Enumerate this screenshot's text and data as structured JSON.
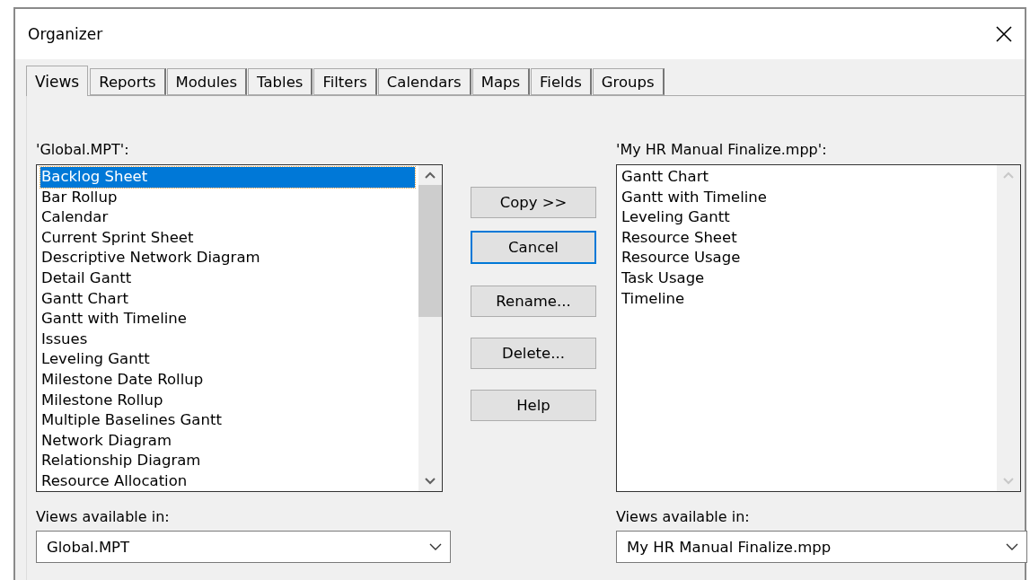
{
  "window": {
    "title": "Organizer"
  },
  "tabs": [
    {
      "label": "Views",
      "selected": true
    },
    {
      "label": "Reports",
      "selected": false
    },
    {
      "label": "Modules",
      "selected": false
    },
    {
      "label": "Tables",
      "selected": false
    },
    {
      "label": "Filters",
      "selected": false
    },
    {
      "label": "Calendars",
      "selected": false
    },
    {
      "label": "Maps",
      "selected": false
    },
    {
      "label": "Fields",
      "selected": false
    },
    {
      "label": "Groups",
      "selected": false
    }
  ],
  "left_list": {
    "label": "'Global.MPT':",
    "items": [
      {
        "label": "Backlog Sheet",
        "selected": true
      },
      {
        "label": "Bar Rollup",
        "selected": false
      },
      {
        "label": "Calendar",
        "selected": false
      },
      {
        "label": "Current Sprint Sheet",
        "selected": false
      },
      {
        "label": "Descriptive Network Diagram",
        "selected": false
      },
      {
        "label": "Detail Gantt",
        "selected": false
      },
      {
        "label": "Gantt Chart",
        "selected": false
      },
      {
        "label": "Gantt with Timeline",
        "selected": false
      },
      {
        "label": "Issues",
        "selected": false
      },
      {
        "label": "Leveling Gantt",
        "selected": false
      },
      {
        "label": "Milestone Date Rollup",
        "selected": false
      },
      {
        "label": "Milestone Rollup",
        "selected": false
      },
      {
        "label": "Multiple Baselines Gantt",
        "selected": false
      },
      {
        "label": "Network Diagram",
        "selected": false
      },
      {
        "label": "Relationship Diagram",
        "selected": false
      },
      {
        "label": "Resource Allocation",
        "selected": false
      }
    ],
    "available_label": "Views available in:",
    "available_value": "Global.MPT"
  },
  "buttons": [
    {
      "label": "Copy >>",
      "focused": false
    },
    {
      "label": "Cancel",
      "focused": true
    },
    {
      "label": "Rename...",
      "focused": false
    },
    {
      "label": "Delete...",
      "focused": false
    },
    {
      "label": "Help",
      "focused": false
    }
  ],
  "right_list": {
    "label": "'My HR Manual Finalize.mpp':",
    "items": [
      {
        "label": "Gantt Chart",
        "selected": false
      },
      {
        "label": "Gantt with Timeline",
        "selected": false
      },
      {
        "label": "Leveling Gantt",
        "selected": false
      },
      {
        "label": "Resource Sheet",
        "selected": false
      },
      {
        "label": "Resource Usage",
        "selected": false
      },
      {
        "label": "Task Usage",
        "selected": false
      },
      {
        "label": "Timeline",
        "selected": false
      }
    ],
    "available_label": "Views available in:",
    "available_value": "My HR Manual Finalize.mpp"
  }
}
